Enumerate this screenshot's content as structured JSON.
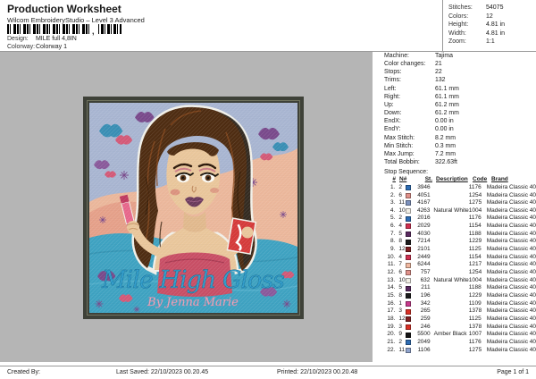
{
  "header": {
    "title": "Production Worksheet",
    "subtitle": "Wilcom EmbroideryStudio – Level 3 Advanced",
    "design_label": "Design:",
    "design_value": "MILE full 4,8IN",
    "colorway_label": "Colorway:",
    "colorway_value": "Colorway 1",
    "barcode_comma": ",",
    "stats": [
      {
        "label": "Stitches:",
        "value": "54075"
      },
      {
        "label": "Colors:",
        "value": "12"
      },
      {
        "label": "Height:",
        "value": "4.81 in"
      },
      {
        "label": "Width:",
        "value": "4.81 in"
      },
      {
        "label": "Zoom:",
        "value": "1:1"
      }
    ]
  },
  "machine_info": [
    {
      "label": "Machine:",
      "value": "Tajima"
    },
    {
      "label": "Color changes:",
      "value": "21"
    },
    {
      "label": "Stops:",
      "value": "22"
    },
    {
      "label": "Trims:",
      "value": "132"
    },
    {
      "label": "Left:",
      "value": "61.1 mm"
    },
    {
      "label": "Right:",
      "value": "61.1 mm"
    },
    {
      "label": "Up:",
      "value": "61.2 mm"
    },
    {
      "label": "Down:",
      "value": "61.2 mm"
    },
    {
      "label": "EndX:",
      "value": "0.00 in"
    },
    {
      "label": "EndY:",
      "value": "0.00 in"
    },
    {
      "label": "Max Stitch:",
      "value": "8.2 mm"
    },
    {
      "label": "Min Stitch:",
      "value": "0.3 mm"
    },
    {
      "label": "Max Jump:",
      "value": "7.2 mm"
    },
    {
      "label": "Total Bobbin:",
      "value": "322.63ft"
    }
  ],
  "stop_sequence": {
    "title": "Stop Sequence:",
    "columns": [
      "#",
      "N#",
      "",
      "St.",
      "Description",
      "Code",
      "Brand"
    ],
    "rows": [
      {
        "num": "1.",
        "needle": "2",
        "color": "#2e6db4",
        "st": "3946",
        "desc": "",
        "code": "1176",
        "brand": "Madeira Classic 40"
      },
      {
        "num": "2.",
        "needle": "6",
        "color": "#e0918a",
        "st": "4051",
        "desc": "",
        "code": "1254",
        "brand": "Madeira Classic 40"
      },
      {
        "num": "3.",
        "needle": "11",
        "color": "#7d92be",
        "st": "4167",
        "desc": "",
        "code": "1275",
        "brand": "Madeira Classic 40"
      },
      {
        "num": "4.",
        "needle": "10",
        "color": "#f2efe6",
        "st": "4263",
        "desc": "Natural White",
        "code": "1004",
        "brand": "Madeira Classic 40"
      },
      {
        "num": "5.",
        "needle": "2",
        "color": "#2e6db4",
        "st": "2016",
        "desc": "",
        "code": "1176",
        "brand": "Madeira Classic 40"
      },
      {
        "num": "6.",
        "needle": "4",
        "color": "#cf3050",
        "st": "2029",
        "desc": "",
        "code": "1154",
        "brand": "Madeira Classic 40"
      },
      {
        "num": "7.",
        "needle": "5",
        "color": "#5a2a60",
        "st": "4030",
        "desc": "",
        "code": "1188",
        "brand": "Madeira Classic 40"
      },
      {
        "num": "8.",
        "needle": "8",
        "color": "#1c1c1c",
        "st": "7214",
        "desc": "",
        "code": "1229",
        "brand": "Madeira Classic 40"
      },
      {
        "num": "9.",
        "needle": "12",
        "color": "#7e2022",
        "st": "2101",
        "desc": "",
        "code": "1125",
        "brand": "Madeira Classic 40"
      },
      {
        "num": "10.",
        "needle": "4",
        "color": "#cf3050",
        "st": "2449",
        "desc": "",
        "code": "1154",
        "brand": "Madeira Classic 40"
      },
      {
        "num": "11.",
        "needle": "7",
        "color": "#f0b8a0",
        "st": "6244",
        "desc": "",
        "code": "1217",
        "brand": "Madeira Classic 40"
      },
      {
        "num": "12.",
        "needle": "6",
        "color": "#e0918a",
        "st": "757",
        "desc": "",
        "code": "1254",
        "brand": "Madeira Classic 40"
      },
      {
        "num": "13.",
        "needle": "10",
        "color": "#f2efe6",
        "st": "632",
        "desc": "Natural White",
        "code": "1004",
        "brand": "Madeira Classic 40"
      },
      {
        "num": "14.",
        "needle": "5",
        "color": "#5a2a60",
        "st": "211",
        "desc": "",
        "code": "1188",
        "brand": "Madeira Classic 40"
      },
      {
        "num": "15.",
        "needle": "8",
        "color": "#1c1c1c",
        "st": "196",
        "desc": "",
        "code": "1229",
        "brand": "Madeira Classic 40"
      },
      {
        "num": "16.",
        "needle": "1",
        "color": "#c73a8c",
        "st": "342",
        "desc": "",
        "code": "1109",
        "brand": "Madeira Classic 40"
      },
      {
        "num": "17.",
        "needle": "3",
        "color": "#d93025",
        "st": "265",
        "desc": "",
        "code": "1378",
        "brand": "Madeira Classic 40"
      },
      {
        "num": "18.",
        "needle": "12",
        "color": "#7e2022",
        "st": "259",
        "desc": "",
        "code": "1125",
        "brand": "Madeira Classic 40"
      },
      {
        "num": "19.",
        "needle": "3",
        "color": "#d93025",
        "st": "246",
        "desc": "",
        "code": "1378",
        "brand": "Madeira Classic 40"
      },
      {
        "num": "20.",
        "needle": "9",
        "color": "#141414",
        "st": "5500",
        "desc": "Amber Black",
        "code": "1007",
        "brand": "Madeira Classic 40"
      },
      {
        "num": "21.",
        "needle": "2",
        "color": "#2e6db4",
        "st": "2049",
        "desc": "",
        "code": "1176",
        "brand": "Madeira Classic 40"
      },
      {
        "num": "22.",
        "needle": "11",
        "color": "#8fa3cc",
        "st": "1106",
        "desc": "",
        "code": "1275",
        "brand": "Madeira Classic 40"
      }
    ]
  },
  "design_preview": {
    "script_line1": "Mile High Gloss",
    "script_line2": "By Jenna Marie"
  },
  "footer": {
    "created_by": "Created By:",
    "last_saved": "Last Saved: 22/10/2023 00.20.45",
    "printed": "Printed: 22/10/2023 00.20.48",
    "page": "Page 1 of 1"
  },
  "colors": {
    "canvas_gray": "#b5b5b5",
    "frame_dark": "#3e4138",
    "sky": "#a9b6d2",
    "mountain_peach": "#ecb89c",
    "water_teal": "#3fa3c2",
    "script_blue": "#2f9bc9"
  }
}
